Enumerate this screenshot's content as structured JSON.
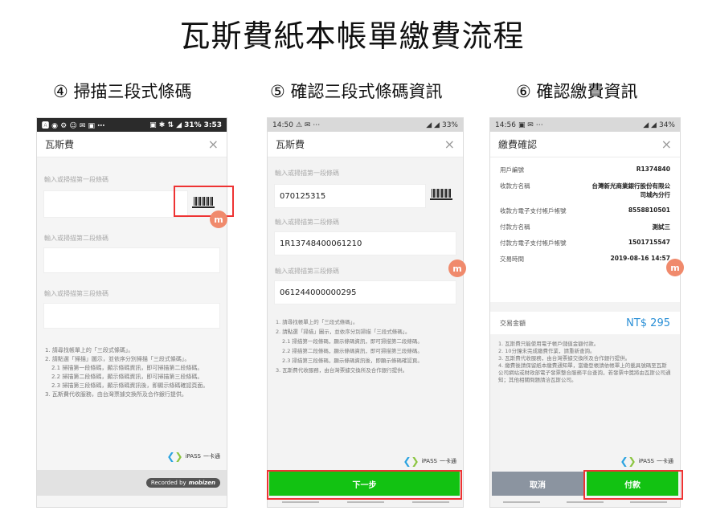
{
  "page": {
    "title": "瓦斯費紙本帳單繳費流程"
  },
  "steps": [
    {
      "label": "④ 掃描三段式條碼"
    },
    {
      "label": "⑤ 確認三段式條碼資訊"
    },
    {
      "label": "⑥ 確認繳費資訊"
    }
  ],
  "screen1": {
    "status": {
      "time": "3:53",
      "battery": "31%",
      "icons": "🅰 ◉ ⚙ ☺ ✉ ▣ ⋯",
      "signal": "▣ ✱ ⇅ ◢"
    },
    "header": {
      "title": "瓦斯費",
      "close": "×"
    },
    "fields": [
      {
        "label": "輸入或掃描第一段條碼"
      },
      {
        "label": "輸入或掃描第二段條碼"
      },
      {
        "label": "輸入或掃描第三段條碼"
      }
    ],
    "notes": [
      "1. 請尋找帳單上的「三段式條碼」。",
      "2. 請點選「掃描」圖示，並依序分別掃描「三段式條碼」。",
      "2.1 掃描第一段條碼，顯示條碼資訊，即可掃描第二段條碼。",
      "2.2 掃描第二段條碼，顯示條碼資訊，即可掃描第三段條碼。",
      "2.3 掃描第三段條碼，顯示條碼資訊後，即顯示條碼確認頁面。",
      "3. 瓦斯費代收服務，由台灣票據交換所及合作銀行提供。"
    ],
    "ipass": {
      "brand": "iPASS",
      "sub": "一卡通"
    },
    "badge": "m",
    "recorded": {
      "text": "Recorded by",
      "brand": "mobizen"
    }
  },
  "screen2": {
    "status": {
      "time": "14:50",
      "battery": "33%",
      "icons": "⚠ ✉ ⋯",
      "signal": "◢ ◢"
    },
    "header": {
      "title": "瓦斯費",
      "close": "×"
    },
    "fields": [
      {
        "label": "輸入或掃描第一段條碼",
        "value": "070125315"
      },
      {
        "label": "輸入或掃描第二段條碼",
        "value": "1R13748400061210"
      },
      {
        "label": "輸入或掃描第三段條碼",
        "value": "061244000000295"
      }
    ],
    "notes": [
      "1. 請尋找帳單上的「三段式條碼」。",
      "2. 請點選「掃描」圖示，並依序分別掃描「三段式條碼」。",
      "2.1 掃描第一段條碼，顯示條碼資訊，即可掃描第二段條碼。",
      "2.2 掃描第二段條碼，顯示條碼資訊，即可掃描第三段條碼。",
      "2.3 掃描第三段條碼，顯示條碼資訊後，即顯示條碼確認頁。",
      "3. 瓦斯費代收服務，由台灣票據交換所及合作銀行提供。"
    ],
    "ipass": {
      "brand": "iPASS",
      "sub": "一卡通"
    },
    "badge": "m",
    "next_button": "下一步"
  },
  "screen3": {
    "status": {
      "time": "14:56",
      "battery": "34%",
      "icons": "▣ ✉ ⋯",
      "signal": "◢ ◢"
    },
    "header": {
      "title": "繳費確認",
      "close": "×"
    },
    "rows": [
      {
        "k": "用戶編號",
        "v": "R1374840"
      },
      {
        "k": "收款方名稱",
        "v": "台灣新光商業銀行股份有限公司城內分行"
      },
      {
        "k": "收款方電子支付帳戶帳號",
        "v": "8558810501"
      },
      {
        "k": "付款方名稱",
        "v": "測試三"
      },
      {
        "k": "付款方電子支付帳戶帳號",
        "v": "1501715547"
      },
      {
        "k": "交易時間",
        "v": "2019-08-16 14:57"
      }
    ],
    "amount": {
      "label": "交易金額",
      "value": "NT$ 295"
    },
    "notes": [
      "1. 瓦斯費只能使用電子帳戶儲值金額付款。",
      "2. 10分鐘未完成繳費作業，請重新查詢。",
      "3. 瓦斯費代收服務，由台灣票據交換所及合作銀行提供。",
      "4. 繳費後請保留紙本繳費通知單，當繳登帳請依帳單上的載具號碼至瓦斯公司網站或財政部電子發票整合服務平台查詢，若發票中獎將由瓦斯公司通知；其他相關問題請洽瓦斯公司。"
    ],
    "ipass": {
      "brand": "iPASS",
      "sub": "一卡通"
    },
    "badge": "m",
    "cancel_button": "取消",
    "pay_button": "付款"
  },
  "colors": {
    "accent_green": "#12c212",
    "highlight_red": "#e33333",
    "amount_blue": "#2a8fd6"
  }
}
